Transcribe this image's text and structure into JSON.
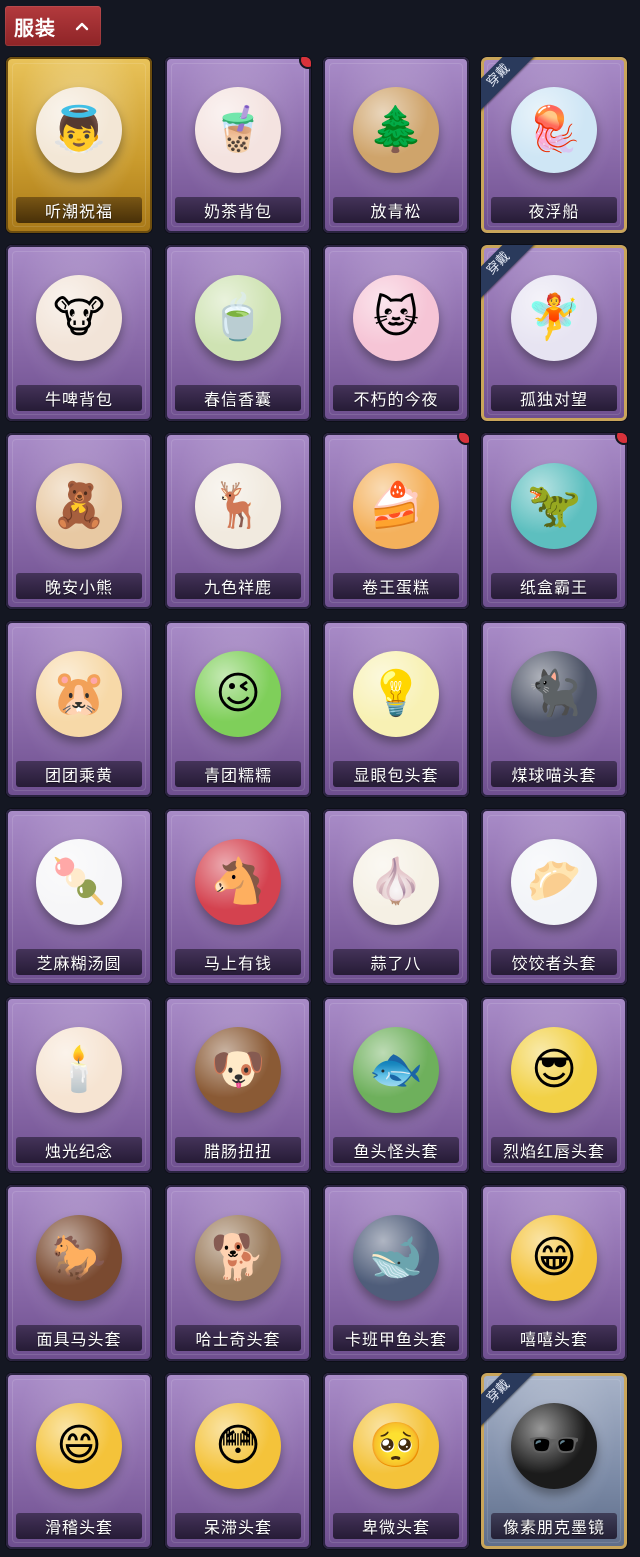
{
  "header": {
    "title": "服装"
  },
  "colors": {
    "tab_red": "#a62e31",
    "bg": "#141722",
    "new_badge": "#d8323a"
  },
  "items": [
    {
      "name": "听潮祝福",
      "style": "gold",
      "worn": false,
      "new": false,
      "icon": "angel-wings-figure",
      "glyph": "👼",
      "tone": "#f3e7d6"
    },
    {
      "name": "奶茶背包",
      "style": "purple",
      "worn": false,
      "new": true,
      "icon": "milk-tea-qr-backpack",
      "glyph": "🧋",
      "tone": "#f4e3e0"
    },
    {
      "name": "放青松",
      "style": "purple",
      "worn": false,
      "new": false,
      "icon": "bonsai-pine",
      "glyph": "🌲",
      "tone": "#cfa46b"
    },
    {
      "name": "夜浮船",
      "style": "purple",
      "worn": true,
      "new": false,
      "icon": "jellyfish-crystal",
      "glyph": "🪼",
      "tone": "#cfe6f5"
    },
    {
      "name": "牛啤背包",
      "style": "purple",
      "worn": false,
      "new": false,
      "icon": "cow-beer-barrel",
      "glyph": "🐮",
      "tone": "#f2e4d8"
    },
    {
      "name": "春信香囊",
      "style": "purple",
      "worn": false,
      "new": false,
      "icon": "green-sachet",
      "glyph": "🍵",
      "tone": "#cfe3b3"
    },
    {
      "name": "不朽的今夜",
      "style": "purple",
      "worn": false,
      "new": false,
      "icon": "pink-cat-teacup",
      "glyph": "🐱",
      "tone": "#f6c5d6"
    },
    {
      "name": "孤独对望",
      "style": "purple",
      "worn": true,
      "new": false,
      "icon": "silver-doll-charm",
      "glyph": "🧚",
      "tone": "#e7e4f2"
    },
    {
      "name": "晚安小熊",
      "style": "purple",
      "worn": false,
      "new": false,
      "icon": "teddy-bear-charm",
      "glyph": "🧸",
      "tone": "#e8c9a3"
    },
    {
      "name": "九色祥鹿",
      "style": "purple",
      "worn": false,
      "new": false,
      "icon": "auspicious-deer",
      "glyph": "🦌",
      "tone": "#f1eadf"
    },
    {
      "name": "卷王蛋糕",
      "style": "purple",
      "worn": false,
      "new": true,
      "icon": "roll-cake",
      "glyph": "🍰",
      "tone": "#f4b15c"
    },
    {
      "name": "纸盒霸王",
      "style": "purple",
      "worn": false,
      "new": true,
      "icon": "cardboard-dino",
      "glyph": "🦖",
      "tone": "#5dbfbf"
    },
    {
      "name": "团团乘黄",
      "style": "purple",
      "worn": false,
      "new": false,
      "icon": "chubby-beast-head",
      "glyph": "🐹",
      "tone": "#f7d9a8"
    },
    {
      "name": "青团糯糯",
      "style": "purple",
      "worn": false,
      "new": false,
      "icon": "green-rice-ball",
      "glyph": "😉",
      "tone": "#7fcf5a"
    },
    {
      "name": "显眼包头套",
      "style": "purple",
      "worn": false,
      "new": false,
      "icon": "lightbulb-king",
      "glyph": "💡",
      "tone": "#f8f1b4"
    },
    {
      "name": "煤球喵头套",
      "style": "purple",
      "worn": false,
      "new": false,
      "icon": "black-cat-head",
      "glyph": "🐈‍⬛",
      "tone": "#4d5467"
    },
    {
      "name": "芝麻糊汤圆",
      "style": "purple",
      "worn": false,
      "new": false,
      "icon": "rice-dumpling-flower",
      "glyph": "🍡",
      "tone": "#f6f6f8"
    },
    {
      "name": "马上有钱",
      "style": "purple",
      "worn": false,
      "new": false,
      "icon": "red-horse-head",
      "glyph": "🐴",
      "tone": "#d4424f"
    },
    {
      "name": "蒜了八",
      "style": "purple",
      "worn": false,
      "new": false,
      "icon": "garlic-head",
      "glyph": "🧄",
      "tone": "#f5f0e4"
    },
    {
      "name": "饺饺者头套",
      "style": "purple",
      "worn": false,
      "new": false,
      "icon": "dumpling-cloud-head",
      "glyph": "🥟",
      "tone": "#f2f4f8"
    },
    {
      "name": "烛光纪念",
      "style": "purple",
      "worn": false,
      "new": false,
      "icon": "candle-head",
      "glyph": "🕯️",
      "tone": "#f6e4d2"
    },
    {
      "name": "腊肠扭扭",
      "style": "purple",
      "worn": false,
      "new": false,
      "icon": "sausage-dog-head",
      "glyph": "🐶",
      "tone": "#8a5a35"
    },
    {
      "name": "鱼头怪头套",
      "style": "purple",
      "worn": false,
      "new": false,
      "icon": "fish-head-mask",
      "glyph": "🐟",
      "tone": "#6eb05c"
    },
    {
      "name": "烈焰红唇头套",
      "style": "purple",
      "worn": false,
      "new": false,
      "icon": "yellow-mouse-shades",
      "glyph": "😎",
      "tone": "#f2d146"
    },
    {
      "name": "面具马头套",
      "style": "purple",
      "worn": false,
      "new": false,
      "icon": "horse-mask",
      "glyph": "🐎",
      "tone": "#7a4a30"
    },
    {
      "name": "哈士奇头套",
      "style": "purple",
      "worn": false,
      "new": false,
      "icon": "husky-shades-head",
      "glyph": "🐕",
      "tone": "#9a7a5a"
    },
    {
      "name": "卡班甲鱼头套",
      "style": "purple",
      "worn": false,
      "new": false,
      "icon": "blue-fish-head",
      "glyph": "🐋",
      "tone": "#4f5d7a"
    },
    {
      "name": "嘻嘻头套",
      "style": "purple",
      "worn": false,
      "new": false,
      "icon": "grin-emoji-head",
      "glyph": "😁",
      "tone": "#f4c33a"
    },
    {
      "name": "滑稽头套",
      "style": "purple",
      "worn": false,
      "new": false,
      "icon": "funny-emoji-head",
      "glyph": "😄",
      "tone": "#f4c33a"
    },
    {
      "name": "呆滞头套",
      "style": "purple",
      "worn": false,
      "new": false,
      "icon": "dazed-emoji-head",
      "glyph": "😳",
      "tone": "#f4c33a"
    },
    {
      "name": "卑微头套",
      "style": "purple",
      "worn": false,
      "new": false,
      "icon": "humble-emoji-head",
      "glyph": "🥺",
      "tone": "#f4c33a"
    },
    {
      "name": "像素朋克墨镜",
      "style": "blue",
      "worn": true,
      "new": false,
      "icon": "pixel-sunglasses",
      "glyph": "🕶️",
      "tone": "#1b1b1b"
    }
  ],
  "badges": {
    "worn_label": "穿戴"
  }
}
